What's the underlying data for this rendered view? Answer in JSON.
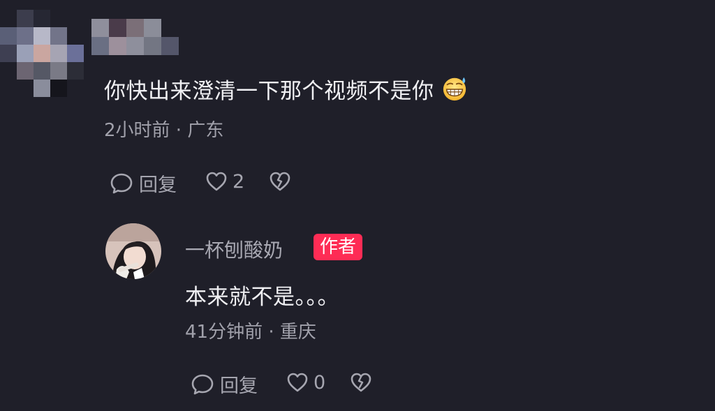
{
  "comment": {
    "text": "你快出来澄清一下那个视频不是你",
    "emoji_icon": "grinning-sweat-face-icon",
    "time_location": "2小时前 · 广东",
    "reply_label": "回复",
    "like_count": "2"
  },
  "reply": {
    "username": "一杯刨酸奶",
    "badge": "作者",
    "badge_color": "#fe2c55",
    "text": "本来就不是。。。",
    "time_location": "41分钟前 · 重庆",
    "reply_label": "回复",
    "like_count": "0"
  }
}
